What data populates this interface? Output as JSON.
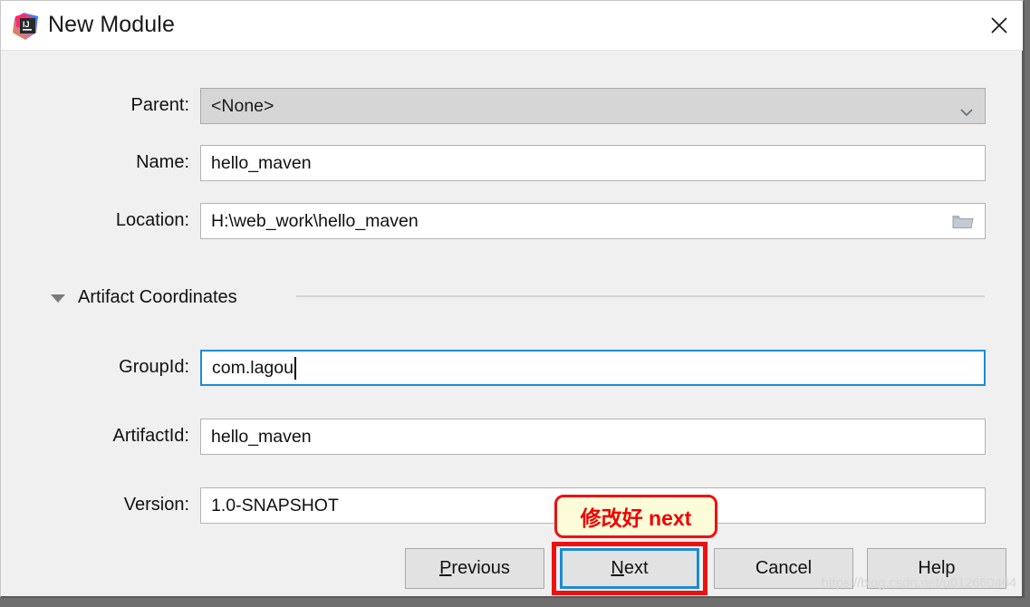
{
  "window": {
    "title": "New Module",
    "app_icon": "intellij-idea-icon",
    "close_icon": "close-icon",
    "accent_focus_color": "#1a8cd8",
    "annotation_color": "#ee1111",
    "background_color": "#f0f0f0",
    "titlebar_color": "#ffffff"
  },
  "form": {
    "rows": [
      {
        "label": "Parent:",
        "value": "<None>",
        "type": "combobox",
        "state": "disabled",
        "icon": "chevron-down-icon"
      },
      {
        "label": "Name:",
        "value": "hello_maven",
        "type": "text",
        "state": "normal",
        "icon": ""
      },
      {
        "label": "Location:",
        "value": "H:\\web_work\\hello_maven",
        "type": "text",
        "state": "normal",
        "icon": "folder-icon"
      }
    ]
  },
  "section": {
    "title": "Artifact Coordinates",
    "expanded": true,
    "toggle_icon": "triangle-down-icon",
    "rows": [
      {
        "label": "GroupId:",
        "value": "com.lagou",
        "state": "focused",
        "has_caret": true
      },
      {
        "label": "ArtifactId:",
        "value": "hello_maven",
        "state": "normal",
        "has_caret": false
      },
      {
        "label": "Version:",
        "value": "1.0-SNAPSHOT",
        "state": "normal",
        "has_caret": false
      }
    ]
  },
  "buttons": [
    {
      "name": "previous",
      "label_pre": "",
      "mnemonic": "P",
      "label_post": "revious",
      "focused": false
    },
    {
      "name": "next",
      "label_pre": "",
      "mnemonic": "N",
      "label_post": "ext",
      "focused": true
    },
    {
      "name": "cancel",
      "label_pre": "Cancel",
      "mnemonic": "",
      "label_post": "",
      "focused": false
    },
    {
      "name": "help",
      "label_pre": "Help",
      "mnemonic": "",
      "label_post": "",
      "focused": false
    }
  ],
  "annotation": {
    "text": "修改好 next"
  },
  "watermark": {
    "text": "https://blog.csdn.net/u012660464"
  }
}
